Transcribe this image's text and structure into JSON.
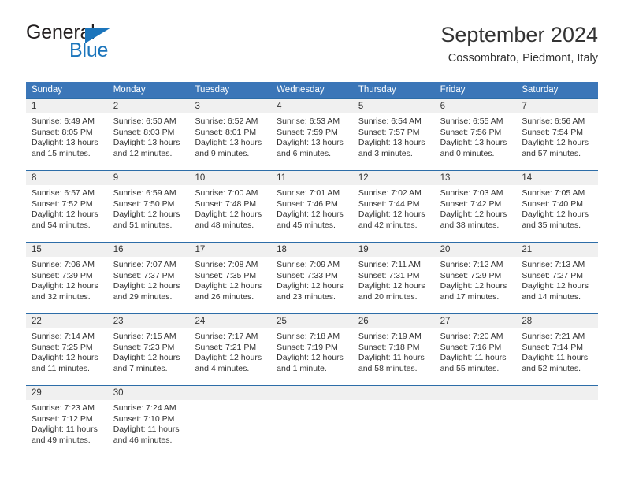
{
  "brand": {
    "name_part1": "General",
    "name_part2": "Blue",
    "triangle_color": "#1b75bc"
  },
  "header": {
    "title": "September 2024",
    "location": "Cossombrato, Piedmont, Italy"
  },
  "theme": {
    "header_blue": "#3b76b8",
    "separator_blue": "#2d6da8",
    "daynum_band": "#f0f0f0",
    "text": "#333333"
  },
  "weekdays": [
    "Sunday",
    "Monday",
    "Tuesday",
    "Wednesday",
    "Thursday",
    "Friday",
    "Saturday"
  ],
  "weeks": [
    {
      "numbers": [
        "1",
        "2",
        "3",
        "4",
        "5",
        "6",
        "7"
      ],
      "days": [
        {
          "sunrise": "Sunrise: 6:49 AM",
          "sunset": "Sunset: 8:05 PM",
          "daylight1": "Daylight: 13 hours",
          "daylight2": "and 15 minutes."
        },
        {
          "sunrise": "Sunrise: 6:50 AM",
          "sunset": "Sunset: 8:03 PM",
          "daylight1": "Daylight: 13 hours",
          "daylight2": "and 12 minutes."
        },
        {
          "sunrise": "Sunrise: 6:52 AM",
          "sunset": "Sunset: 8:01 PM",
          "daylight1": "Daylight: 13 hours",
          "daylight2": "and 9 minutes."
        },
        {
          "sunrise": "Sunrise: 6:53 AM",
          "sunset": "Sunset: 7:59 PM",
          "daylight1": "Daylight: 13 hours",
          "daylight2": "and 6 minutes."
        },
        {
          "sunrise": "Sunrise: 6:54 AM",
          "sunset": "Sunset: 7:57 PM",
          "daylight1": "Daylight: 13 hours",
          "daylight2": "and 3 minutes."
        },
        {
          "sunrise": "Sunrise: 6:55 AM",
          "sunset": "Sunset: 7:56 PM",
          "daylight1": "Daylight: 13 hours",
          "daylight2": "and 0 minutes."
        },
        {
          "sunrise": "Sunrise: 6:56 AM",
          "sunset": "Sunset: 7:54 PM",
          "daylight1": "Daylight: 12 hours",
          "daylight2": "and 57 minutes."
        }
      ]
    },
    {
      "numbers": [
        "8",
        "9",
        "10",
        "11",
        "12",
        "13",
        "14"
      ],
      "days": [
        {
          "sunrise": "Sunrise: 6:57 AM",
          "sunset": "Sunset: 7:52 PM",
          "daylight1": "Daylight: 12 hours",
          "daylight2": "and 54 minutes."
        },
        {
          "sunrise": "Sunrise: 6:59 AM",
          "sunset": "Sunset: 7:50 PM",
          "daylight1": "Daylight: 12 hours",
          "daylight2": "and 51 minutes."
        },
        {
          "sunrise": "Sunrise: 7:00 AM",
          "sunset": "Sunset: 7:48 PM",
          "daylight1": "Daylight: 12 hours",
          "daylight2": "and 48 minutes."
        },
        {
          "sunrise": "Sunrise: 7:01 AM",
          "sunset": "Sunset: 7:46 PM",
          "daylight1": "Daylight: 12 hours",
          "daylight2": "and 45 minutes."
        },
        {
          "sunrise": "Sunrise: 7:02 AM",
          "sunset": "Sunset: 7:44 PM",
          "daylight1": "Daylight: 12 hours",
          "daylight2": "and 42 minutes."
        },
        {
          "sunrise": "Sunrise: 7:03 AM",
          "sunset": "Sunset: 7:42 PM",
          "daylight1": "Daylight: 12 hours",
          "daylight2": "and 38 minutes."
        },
        {
          "sunrise": "Sunrise: 7:05 AM",
          "sunset": "Sunset: 7:40 PM",
          "daylight1": "Daylight: 12 hours",
          "daylight2": "and 35 minutes."
        }
      ]
    },
    {
      "numbers": [
        "15",
        "16",
        "17",
        "18",
        "19",
        "20",
        "21"
      ],
      "days": [
        {
          "sunrise": "Sunrise: 7:06 AM",
          "sunset": "Sunset: 7:39 PM",
          "daylight1": "Daylight: 12 hours",
          "daylight2": "and 32 minutes."
        },
        {
          "sunrise": "Sunrise: 7:07 AM",
          "sunset": "Sunset: 7:37 PM",
          "daylight1": "Daylight: 12 hours",
          "daylight2": "and 29 minutes."
        },
        {
          "sunrise": "Sunrise: 7:08 AM",
          "sunset": "Sunset: 7:35 PM",
          "daylight1": "Daylight: 12 hours",
          "daylight2": "and 26 minutes."
        },
        {
          "sunrise": "Sunrise: 7:09 AM",
          "sunset": "Sunset: 7:33 PM",
          "daylight1": "Daylight: 12 hours",
          "daylight2": "and 23 minutes."
        },
        {
          "sunrise": "Sunrise: 7:11 AM",
          "sunset": "Sunset: 7:31 PM",
          "daylight1": "Daylight: 12 hours",
          "daylight2": "and 20 minutes."
        },
        {
          "sunrise": "Sunrise: 7:12 AM",
          "sunset": "Sunset: 7:29 PM",
          "daylight1": "Daylight: 12 hours",
          "daylight2": "and 17 minutes."
        },
        {
          "sunrise": "Sunrise: 7:13 AM",
          "sunset": "Sunset: 7:27 PM",
          "daylight1": "Daylight: 12 hours",
          "daylight2": "and 14 minutes."
        }
      ]
    },
    {
      "numbers": [
        "22",
        "23",
        "24",
        "25",
        "26",
        "27",
        "28"
      ],
      "days": [
        {
          "sunrise": "Sunrise: 7:14 AM",
          "sunset": "Sunset: 7:25 PM",
          "daylight1": "Daylight: 12 hours",
          "daylight2": "and 11 minutes."
        },
        {
          "sunrise": "Sunrise: 7:15 AM",
          "sunset": "Sunset: 7:23 PM",
          "daylight1": "Daylight: 12 hours",
          "daylight2": "and 7 minutes."
        },
        {
          "sunrise": "Sunrise: 7:17 AM",
          "sunset": "Sunset: 7:21 PM",
          "daylight1": "Daylight: 12 hours",
          "daylight2": "and 4 minutes."
        },
        {
          "sunrise": "Sunrise: 7:18 AM",
          "sunset": "Sunset: 7:19 PM",
          "daylight1": "Daylight: 12 hours",
          "daylight2": "and 1 minute."
        },
        {
          "sunrise": "Sunrise: 7:19 AM",
          "sunset": "Sunset: 7:18 PM",
          "daylight1": "Daylight: 11 hours",
          "daylight2": "and 58 minutes."
        },
        {
          "sunrise": "Sunrise: 7:20 AM",
          "sunset": "Sunset: 7:16 PM",
          "daylight1": "Daylight: 11 hours",
          "daylight2": "and 55 minutes."
        },
        {
          "sunrise": "Sunrise: 7:21 AM",
          "sunset": "Sunset: 7:14 PM",
          "daylight1": "Daylight: 11 hours",
          "daylight2": "and 52 minutes."
        }
      ]
    },
    {
      "numbers": [
        "29",
        "30",
        "",
        "",
        "",
        "",
        ""
      ],
      "days": [
        {
          "sunrise": "Sunrise: 7:23 AM",
          "sunset": "Sunset: 7:12 PM",
          "daylight1": "Daylight: 11 hours",
          "daylight2": "and 49 minutes."
        },
        {
          "sunrise": "Sunrise: 7:24 AM",
          "sunset": "Sunset: 7:10 PM",
          "daylight1": "Daylight: 11 hours",
          "daylight2": "and 46 minutes."
        },
        {
          "sunrise": "",
          "sunset": "",
          "daylight1": "",
          "daylight2": ""
        },
        {
          "sunrise": "",
          "sunset": "",
          "daylight1": "",
          "daylight2": ""
        },
        {
          "sunrise": "",
          "sunset": "",
          "daylight1": "",
          "daylight2": ""
        },
        {
          "sunrise": "",
          "sunset": "",
          "daylight1": "",
          "daylight2": ""
        },
        {
          "sunrise": "",
          "sunset": "",
          "daylight1": "",
          "daylight2": ""
        }
      ]
    }
  ]
}
